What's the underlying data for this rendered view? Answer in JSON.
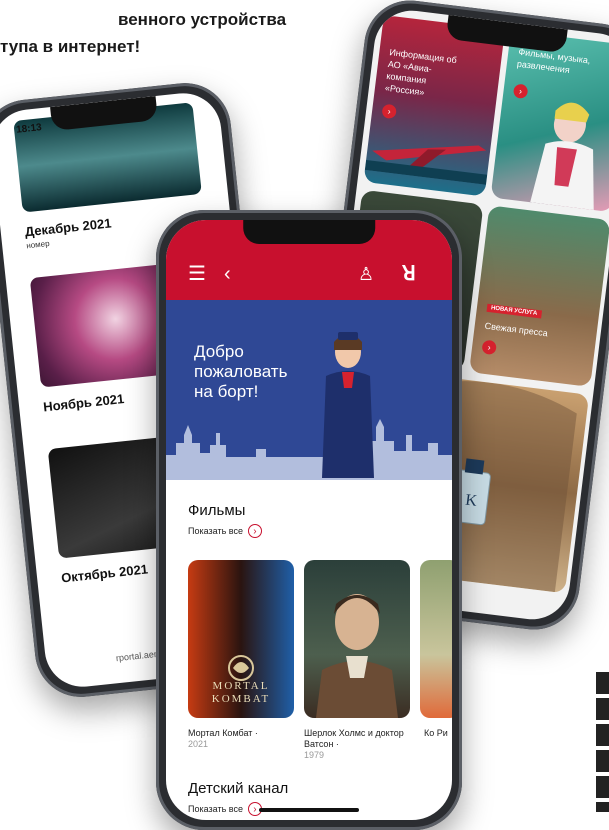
{
  "headline": {
    "line1": "венного устройства",
    "line2": "тупа в интернет!"
  },
  "right_phone": {
    "tile_airline": "Информация об АО «Авиа-компания «Россия»",
    "tile_movies": "Фильмы, музыка, развлечения",
    "tile_press_badge": "НОВАЯ УСЛУГА",
    "tile_press": "Свежая пресса"
  },
  "left_phone": {
    "time": "18:13",
    "magazines": [
      {
        "title": "Декабрь 2021",
        "subtitle": "номер"
      },
      {
        "title": "Ноябрь 2021",
        "subtitle": ""
      },
      {
        "title": "Октябрь 2021",
        "subtitle": ""
      }
    ],
    "url": "rportal.aero"
  },
  "front_phone": {
    "welcome_line1": "Добро",
    "welcome_line2": "пожаловать",
    "welcome_line3": "на борт!",
    "films_section": "Фильмы",
    "show_all": "Показать все",
    "films": [
      {
        "title": "Мортал Комбат ·",
        "year": "2021",
        "poster_text": "MORTAL KOMBAT"
      },
      {
        "title": "Шерлок Холмс и доктор Ватсон ·",
        "year": "1979"
      },
      {
        "title": "Ко Ри",
        "year": ""
      }
    ],
    "kids_section": "Детский канал",
    "show_all_kids": "Показать все"
  },
  "colors": {
    "brand_red": "#c8102e",
    "banner_blue": "#2f4895",
    "phone_body": "#2b2d31"
  }
}
